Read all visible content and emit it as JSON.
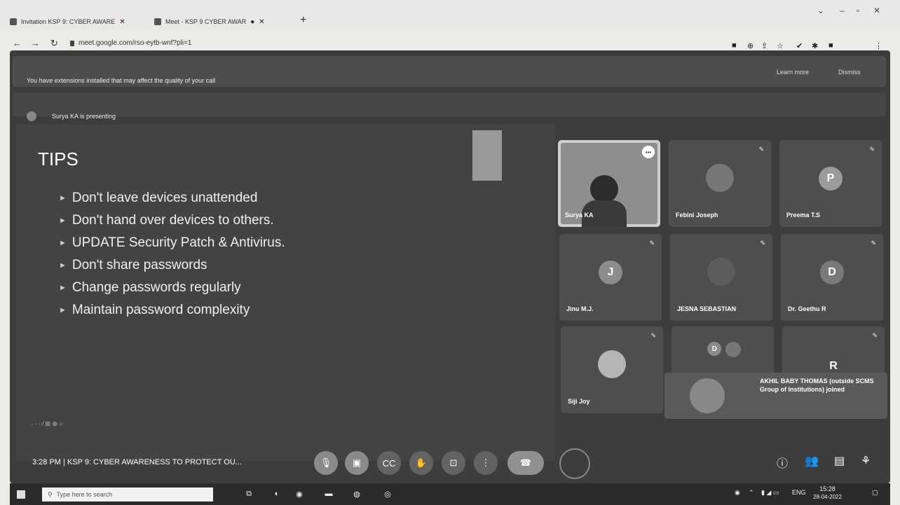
{
  "browser": {
    "tabs": [
      {
        "title": "Invitation KSP 9: CYBER AWARE"
      },
      {
        "title": "Meet - KSP 9 CYBER AWAR"
      }
    ],
    "url": "meet.google.com/rso-eytb-wnf?pli=1"
  },
  "banner": {
    "message": "You have extensions installed that may affect the quality of your call",
    "learn_more": "Learn more",
    "dismiss": "Dismiss"
  },
  "presenting": {
    "text": "Surya KA is presenting"
  },
  "slide": {
    "title": "TIPS",
    "bullets": [
      "Don't leave devices unattended",
      "Don't hand over devices to others.",
      "UPDATE  Security Patch  & Antivirus.",
      "Don't share passwords",
      "Change passwords regularly",
      "Maintain password complexity"
    ]
  },
  "participants": [
    {
      "name": "Surya KA",
      "type": "self"
    },
    {
      "name": "Febini Joseph",
      "type": "photo"
    },
    {
      "name": "Preema T.S",
      "type": "letter",
      "letter": "P",
      "color": "#9b9b9b"
    },
    {
      "name": "Jinu M.J.",
      "type": "letter",
      "letter": "J",
      "color": "#8c8c8c"
    },
    {
      "name": "JESNA SEBASTIAN",
      "type": "photo"
    },
    {
      "name": "Dr. Geethu R",
      "type": "letter",
      "letter": "D",
      "color": "#7a7a7a"
    },
    {
      "name": "Siji Joy",
      "type": "photo"
    },
    {
      "name": "",
      "type": "photo-d",
      "letter": "D"
    },
    {
      "name": "",
      "type": "letter",
      "letter": "R",
      "color": "#6c6c6c"
    }
  ],
  "toast": {
    "text": "AKHIL BABY THOMAS (outside SCMS Group of Institutions) joined"
  },
  "call": {
    "time": "3:28 PM",
    "separator": "|",
    "meeting_title": "KSP 9: CYBER AWARENESS TO PROTECT OU..."
  },
  "taskbar": {
    "search_placeholder": "Type here to search",
    "lang": "ENG",
    "clock_time": "15:28",
    "clock_date": "28-04-2022"
  }
}
